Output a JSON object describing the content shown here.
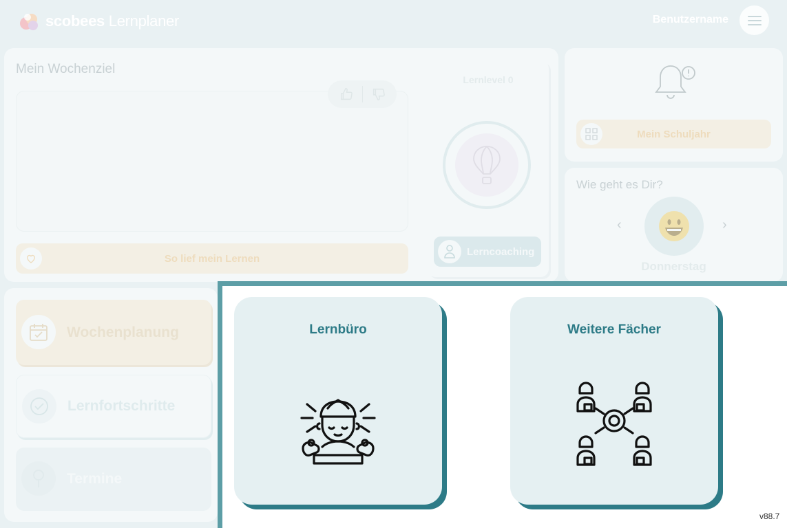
{
  "header": {
    "logo_brand": "scobees",
    "logo_product": "Lernplaner",
    "username": "Benutzername",
    "menu_icon": "hamburger-menu-icon"
  },
  "weekly_goal": {
    "title": "Mein Wochenziel",
    "feedback_button": "So lief mein Lernen",
    "level_title": "Lernlevel 0",
    "coaching_button": "Lerncoaching"
  },
  "notifications": {
    "year_button": "Mein Schuljahr"
  },
  "mood": {
    "title": "Wie geht es Dir?",
    "day": "Donnerstag"
  },
  "nav": {
    "items": [
      {
        "label": "Wochenplanung",
        "icon": "calendar-check-icon"
      },
      {
        "label": "Lernfortschritte",
        "icon": "check-circle-icon"
      },
      {
        "label": "Termine",
        "icon": "pin-icon"
      }
    ]
  },
  "modal": {
    "tiles": [
      {
        "title": "Lernbüro",
        "icon": "meditating-mind-icon"
      },
      {
        "title": "Weitere Fächer",
        "icon": "people-network-icon"
      }
    ]
  },
  "version": "v88.7",
  "colors": {
    "accent": "#2d7b87",
    "modal_border": "#5d9ea6",
    "tile_bg": "#e5f0f2",
    "page_bg": "#e9f1f3"
  }
}
